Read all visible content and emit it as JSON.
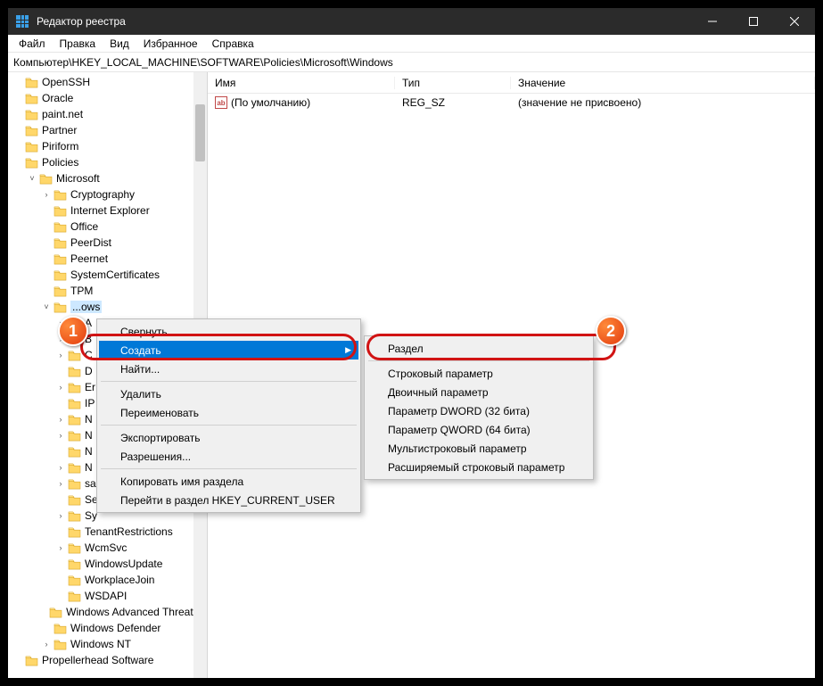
{
  "title": "Редактор реестра",
  "menubar": {
    "items": [
      "Файл",
      "Правка",
      "Вид",
      "Избранное",
      "Справка"
    ]
  },
  "address": "Компьютер\\HKEY_LOCAL_MACHINE\\SOFTWARE\\Policies\\Microsoft\\Windows",
  "columns": {
    "name": "Имя",
    "type": "Тип",
    "value": "Значение"
  },
  "valueRow": {
    "name": "(По умолчанию)",
    "type": "REG_SZ",
    "value": "(значение не присвоено)"
  },
  "tree": [
    {
      "indent": 0,
      "chev": "",
      "label": "OpenSSH"
    },
    {
      "indent": 0,
      "chev": "",
      "label": "Oracle"
    },
    {
      "indent": 0,
      "chev": "",
      "label": "paint.net"
    },
    {
      "indent": 0,
      "chev": "",
      "label": "Partner"
    },
    {
      "indent": 0,
      "chev": "",
      "label": "Piriform"
    },
    {
      "indent": 0,
      "chev": "",
      "label": "Policies"
    },
    {
      "indent": 1,
      "chev": "▾",
      "label": "Microsoft"
    },
    {
      "indent": 2,
      "chev": "›",
      "label": "Cryptography"
    },
    {
      "indent": 2,
      "chev": "",
      "label": "Internet Explorer"
    },
    {
      "indent": 2,
      "chev": "",
      "label": "Office"
    },
    {
      "indent": 2,
      "chev": "",
      "label": "PeerDist"
    },
    {
      "indent": 2,
      "chev": "",
      "label": "Peernet"
    },
    {
      "indent": 2,
      "chev": "",
      "label": "SystemCertificates"
    },
    {
      "indent": 2,
      "chev": "",
      "label": "TPM"
    },
    {
      "indent": 2,
      "chev": "▾",
      "label": "Windows",
      "sel": true,
      "trunc": "...ows"
    },
    {
      "indent": 3,
      "chev": "›",
      "label": "A"
    },
    {
      "indent": 3,
      "chev": "›",
      "label": "B"
    },
    {
      "indent": 3,
      "chev": "›",
      "label": "C"
    },
    {
      "indent": 3,
      "chev": "",
      "label": "D"
    },
    {
      "indent": 3,
      "chev": "›",
      "label": "Er"
    },
    {
      "indent": 3,
      "chev": "",
      "label": "IP"
    },
    {
      "indent": 3,
      "chev": "›",
      "label": "N"
    },
    {
      "indent": 3,
      "chev": "›",
      "label": "N"
    },
    {
      "indent": 3,
      "chev": "",
      "label": "N"
    },
    {
      "indent": 3,
      "chev": "›",
      "label": "N"
    },
    {
      "indent": 3,
      "chev": "›",
      "label": "sa"
    },
    {
      "indent": 3,
      "chev": "",
      "label": "Se"
    },
    {
      "indent": 3,
      "chev": "›",
      "label": "Sy"
    },
    {
      "indent": 3,
      "chev": "",
      "label": "TenantRestrictions"
    },
    {
      "indent": 3,
      "chev": "›",
      "label": "WcmSvc"
    },
    {
      "indent": 3,
      "chev": "",
      "label": "WindowsUpdate"
    },
    {
      "indent": 3,
      "chev": "",
      "label": "WorkplaceJoin"
    },
    {
      "indent": 3,
      "chev": "",
      "label": "WSDAPI"
    },
    {
      "indent": 2,
      "chev": "",
      "label": "Windows Advanced Threat P"
    },
    {
      "indent": 2,
      "chev": "",
      "label": "Windows Defender"
    },
    {
      "indent": 2,
      "chev": "›",
      "label": "Windows NT"
    },
    {
      "indent": 0,
      "chev": "",
      "label": "Propellerhead Software"
    }
  ],
  "ctx1": {
    "collapse": "Свернуть",
    "create": "Создать",
    "find": "Найти...",
    "delete": "Удалить",
    "rename": "Переименовать",
    "export": "Экспортировать",
    "permissions": "Разрешения...",
    "copyKeyName": "Копировать имя раздела",
    "gotoHKCU": "Перейти в раздел HKEY_CURRENT_USER"
  },
  "ctx2": {
    "key": "Раздел",
    "string": "Строковый параметр",
    "binary": "Двоичный параметр",
    "dword": "Параметр DWORD (32 бита)",
    "qword": "Параметр QWORD (64 бита)",
    "multi": "Мультистроковый параметр",
    "expand": "Расширяемый строковый параметр"
  },
  "badges": {
    "one": "1",
    "two": "2"
  }
}
